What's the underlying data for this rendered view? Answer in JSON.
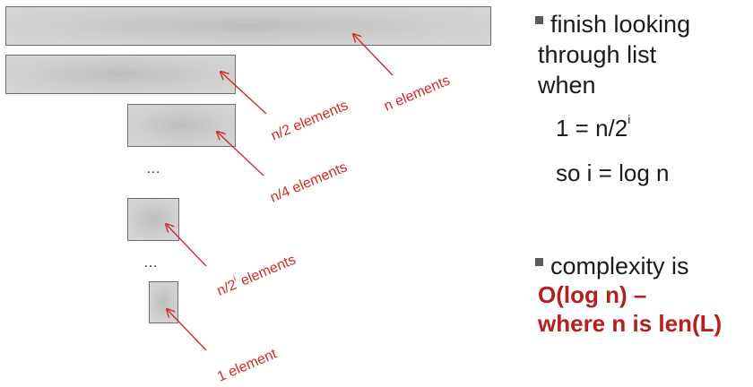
{
  "diagram": {
    "ellipsis_1": "…",
    "ellipsis_2": "…",
    "labels": {
      "n_elements": "n elements",
      "n_half": "n/2 elements",
      "n_quarter": "n/4 elements",
      "n_2i_prefix": "n/2",
      "n_2i_sup": "i",
      "n_2i_suffix": " elements",
      "one_element": "1 element"
    },
    "arrow_color": "#d42a2a"
  },
  "notes": {
    "bullet1": {
      "line1": "finish looking",
      "line2": "through list",
      "line3": "when"
    },
    "eq1_prefix": "1 = n/2",
    "eq1_sup": "i",
    "eq2": "so i = log n",
    "bullet2": "complexity is",
    "result_line1": "O(log n) –",
    "result_line2": "where n is len(L)",
    "result_color": "#b51f1f"
  }
}
